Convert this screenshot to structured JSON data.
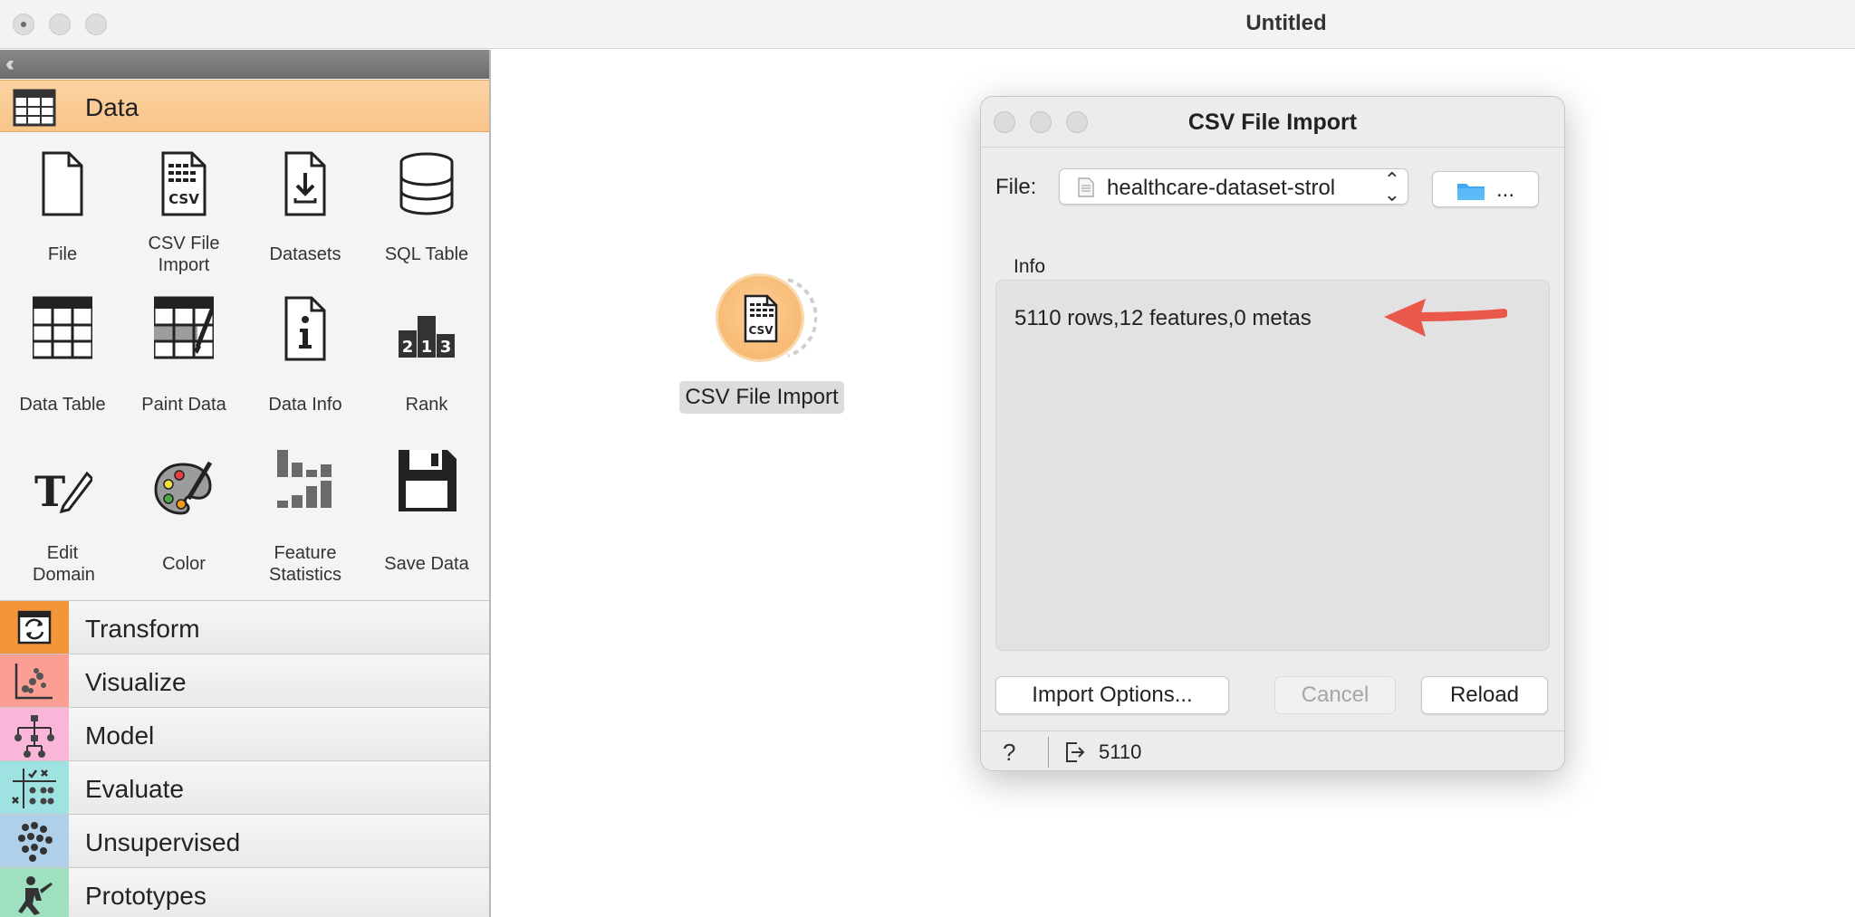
{
  "window": {
    "title": "Untitled"
  },
  "sidebar": {
    "data_category": "Data",
    "widgets": [
      {
        "label": "File",
        "icon": "file-icon"
      },
      {
        "label": "CSV File Import",
        "icon": "csv-file-icon"
      },
      {
        "label": "Datasets",
        "icon": "datasets-icon"
      },
      {
        "label": "SQL Table",
        "icon": "database-icon"
      },
      {
        "label": "Data Table",
        "icon": "table-icon"
      },
      {
        "label": "Paint Data",
        "icon": "paint-data-icon"
      },
      {
        "label": "Data Info",
        "icon": "info-icon"
      },
      {
        "label": "Rank",
        "icon": "rank-icon"
      },
      {
        "label": "Edit Domain",
        "icon": "edit-domain-icon"
      },
      {
        "label": "Color",
        "icon": "palette-icon"
      },
      {
        "label": "Feature Statistics",
        "icon": "feature-statistics-icon"
      },
      {
        "label": "Save Data",
        "icon": "floppy-disk-icon"
      }
    ],
    "categories": [
      {
        "label": "Transform",
        "color": "#f5953a"
      },
      {
        "label": "Visualize",
        "color": "#fb9e94"
      },
      {
        "label": "Model",
        "color": "#fab6d8"
      },
      {
        "label": "Evaluate",
        "color": "#9fe2e2"
      },
      {
        "label": "Unsupervised",
        "color": "#b0cfe8"
      },
      {
        "label": "Prototypes",
        "color": "#9fe0c0"
      }
    ]
  },
  "canvas": {
    "node_label": "CSV File Import",
    "node_color": "#f8bb70"
  },
  "dialog": {
    "title": "CSV File Import",
    "file_label": "File:",
    "file_value": "healthcare-dataset-strol",
    "browse_label": "...",
    "info_label": "Info",
    "info_text": "5110 rows,12 features,0 metas",
    "buttons": {
      "import_options": "Import Options...",
      "cancel": "Cancel",
      "reload": "Reload"
    },
    "status": {
      "help": "?",
      "output_count": "5110"
    },
    "arrow_color": "#e9584b"
  }
}
